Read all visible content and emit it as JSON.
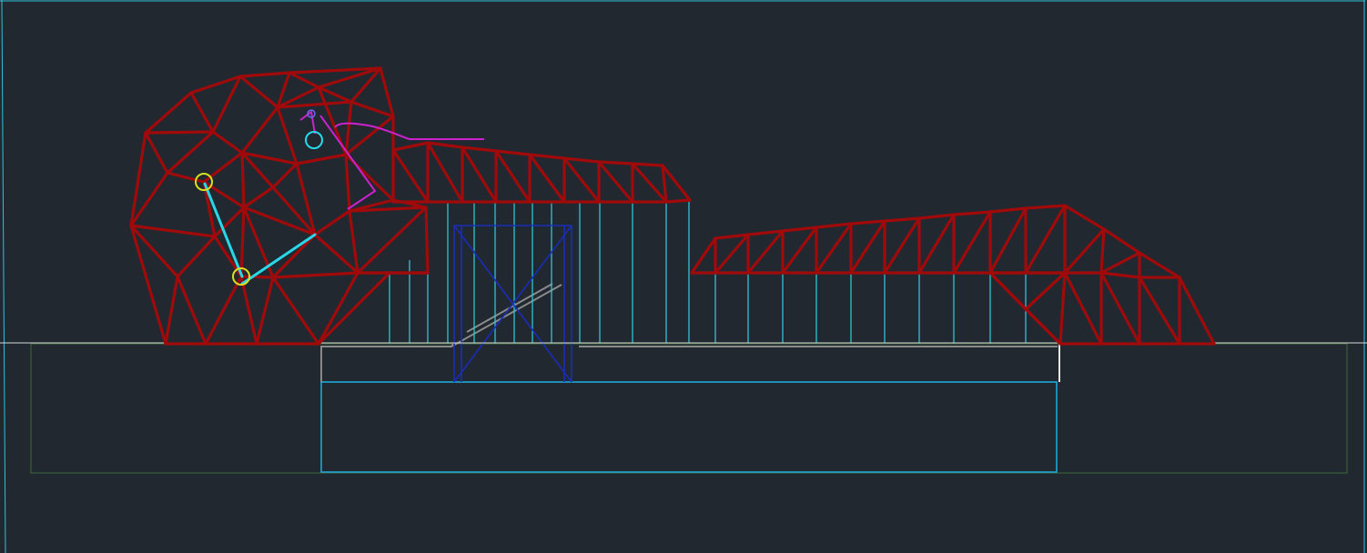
{
  "drawing": {
    "background_color": "#212830",
    "structure_color": "#a10a0a",
    "accent_colors": {
      "cyan": "#2ec4d6",
      "blue": "#1a2db8",
      "magenta": "#cc22cc",
      "yellow": "#d8e020",
      "green": "#3c6b3c",
      "grey": "#8a8a8a"
    },
    "elements": [
      "head-truss-mesh",
      "neck-truss-girder",
      "tail-truss-girder",
      "vertical-support-columns",
      "ground-line",
      "foundation-slab",
      "basin-rectangle",
      "cross-braced-frame",
      "jaw-linkage-arm",
      "magenta-control-line"
    ]
  }
}
